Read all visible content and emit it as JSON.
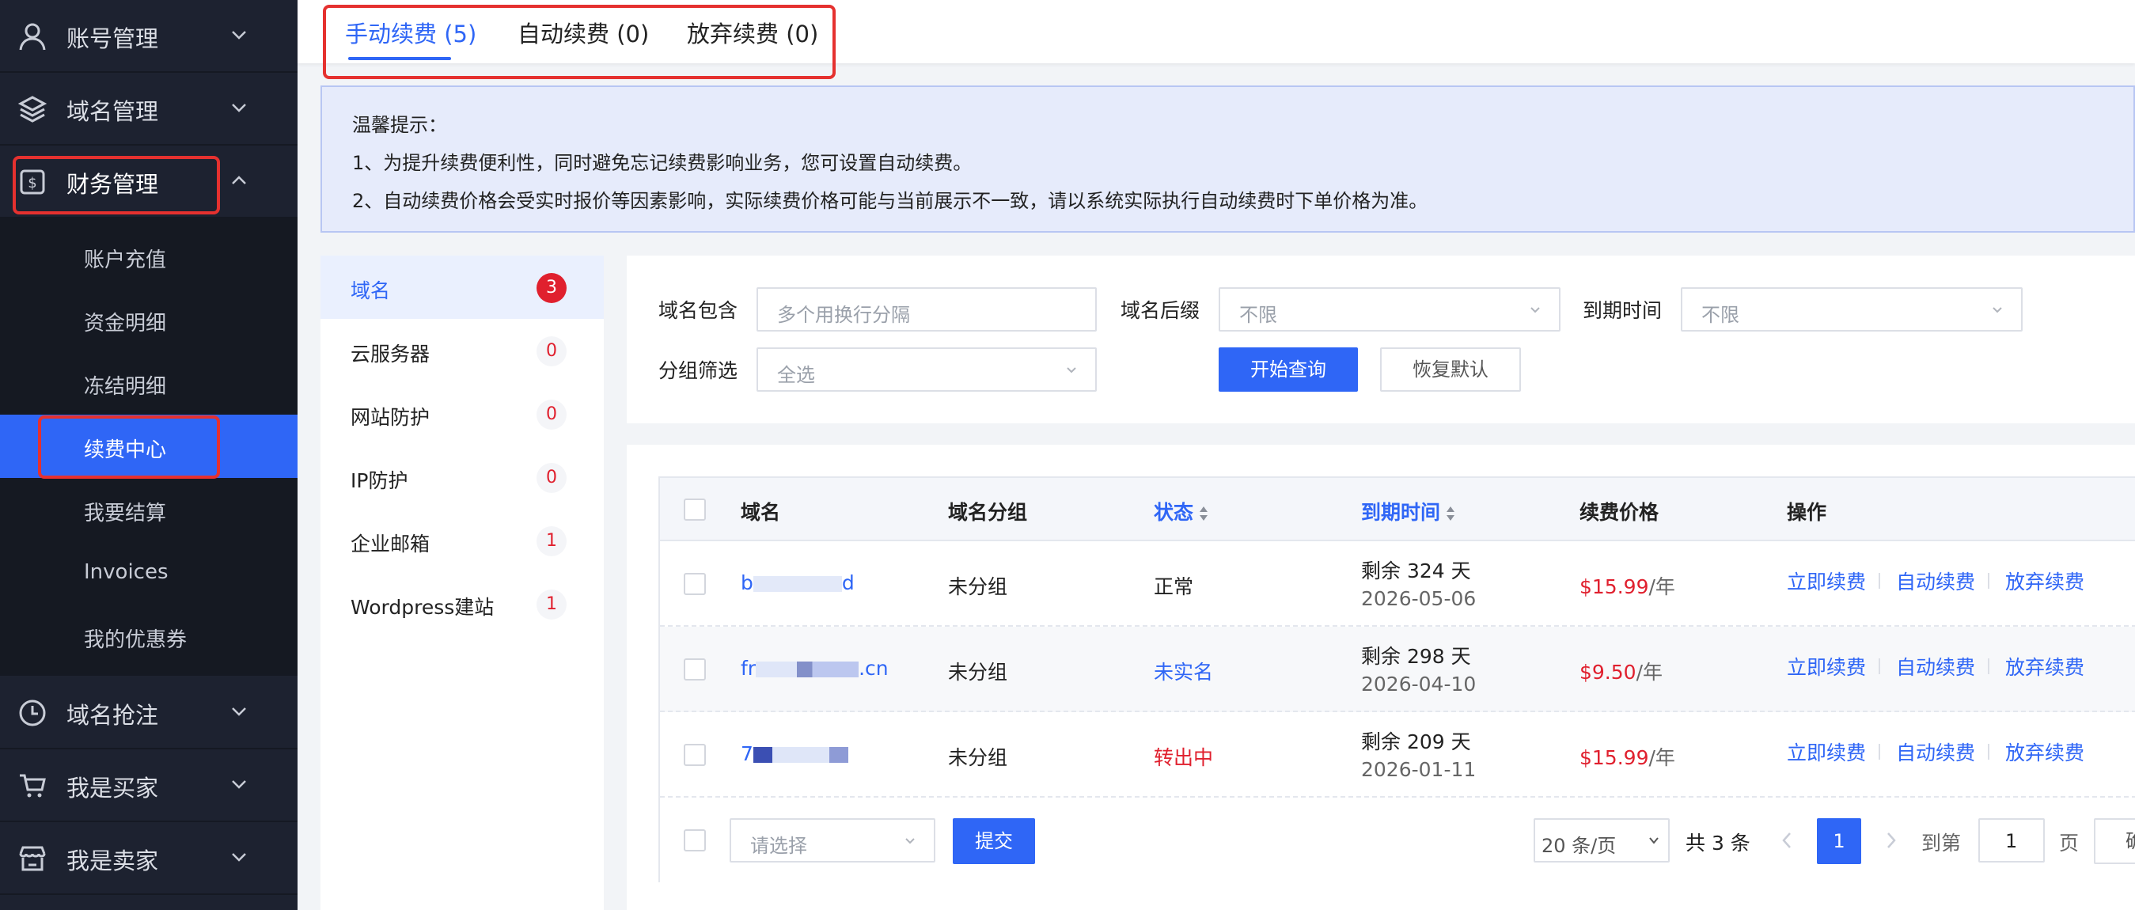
{
  "sidebar": {
    "items": [
      {
        "label": "账号管理",
        "icon": "user-icon"
      },
      {
        "label": "域名管理",
        "icon": "layers-icon"
      },
      {
        "label": "财务管理",
        "icon": "dollar-card-icon"
      },
      {
        "label": "域名抢注",
        "icon": "clock-icon"
      },
      {
        "label": "我是买家",
        "icon": "cart-icon"
      },
      {
        "label": "我是卖家",
        "icon": "store-icon"
      }
    ],
    "finance_submenu": [
      "账户充值",
      "资金明细",
      "冻结明细",
      "续费中心",
      "我要结算",
      "Invoices",
      "我的优惠券"
    ],
    "active_submenu": "续费中心"
  },
  "tabs": [
    {
      "label": "手动续费 (5)"
    },
    {
      "label": "自动续费 (0)"
    },
    {
      "label": "放弃续费 (0)"
    }
  ],
  "notice": {
    "title": "温馨提示：",
    "line1": "1、为提升续费便利性，同时避免忘记续费影响业务，您可设置自动续费。",
    "line2": "2、自动续费价格会受实时报价等因素影响，实际续费价格可能与当前展示不一致，请以系统实际执行自动续费时下单价格为准。"
  },
  "categories": [
    {
      "label": "域名",
      "count": "3"
    },
    {
      "label": "云服务器",
      "count": "0"
    },
    {
      "label": "网站防护",
      "count": "0"
    },
    {
      "label": "IP防护",
      "count": "0"
    },
    {
      "label": "企业邮箱",
      "count": "1"
    },
    {
      "label": "Wordpress建站",
      "count": "1"
    }
  ],
  "filters": {
    "domain_contains_label": "域名包含",
    "domain_contains_placeholder": "多个用换行分隔",
    "suffix_label": "域名后缀",
    "suffix_value": "不限",
    "expiry_label": "到期时间",
    "expiry_value": "不限",
    "group_label": "分组筛选",
    "group_value": "全选",
    "search_button": "开始查询",
    "reset_button": "恢复默认"
  },
  "table": {
    "headers": {
      "domain": "域名",
      "group": "域名分组",
      "status": "状态",
      "expiry": "到期时间",
      "price": "续费价格",
      "actions": "操作"
    },
    "rows": [
      {
        "domain_start": "b",
        "domain_end": "d",
        "group": "未分组",
        "status": "正常",
        "remaining": "剩余 324 天",
        "date": "2026-05-06",
        "price": "$15.99",
        "unit": "/年"
      },
      {
        "domain_start": "fr",
        "domain_end": ".cn",
        "group": "未分组",
        "status": "未实名",
        "remaining": "剩余 298 天",
        "date": "2026-04-10",
        "price": "$9.50",
        "unit": "/年"
      },
      {
        "domain_start": "7",
        "domain_end": "",
        "group": "未分组",
        "status": "转出中",
        "remaining": "剩余 209 天",
        "date": "2026-01-11",
        "price": "$15.99",
        "unit": "/年"
      }
    ],
    "action_labels": {
      "renew_now": "立即续费",
      "auto_renew": "自动续费",
      "abandon": "放弃续费"
    },
    "colors": {
      "normal": "#222222",
      "unverified": "#2f66f6",
      "transferring": "#e0202e"
    }
  },
  "footer": {
    "select_placeholder": "请选择",
    "submit_button": "提交",
    "page_size": "20 条/页",
    "total": "共 3 条",
    "current_page": "1",
    "goto_label": "到第",
    "goto_value": "1",
    "page_suffix": "页",
    "confirm_partial": "确"
  }
}
